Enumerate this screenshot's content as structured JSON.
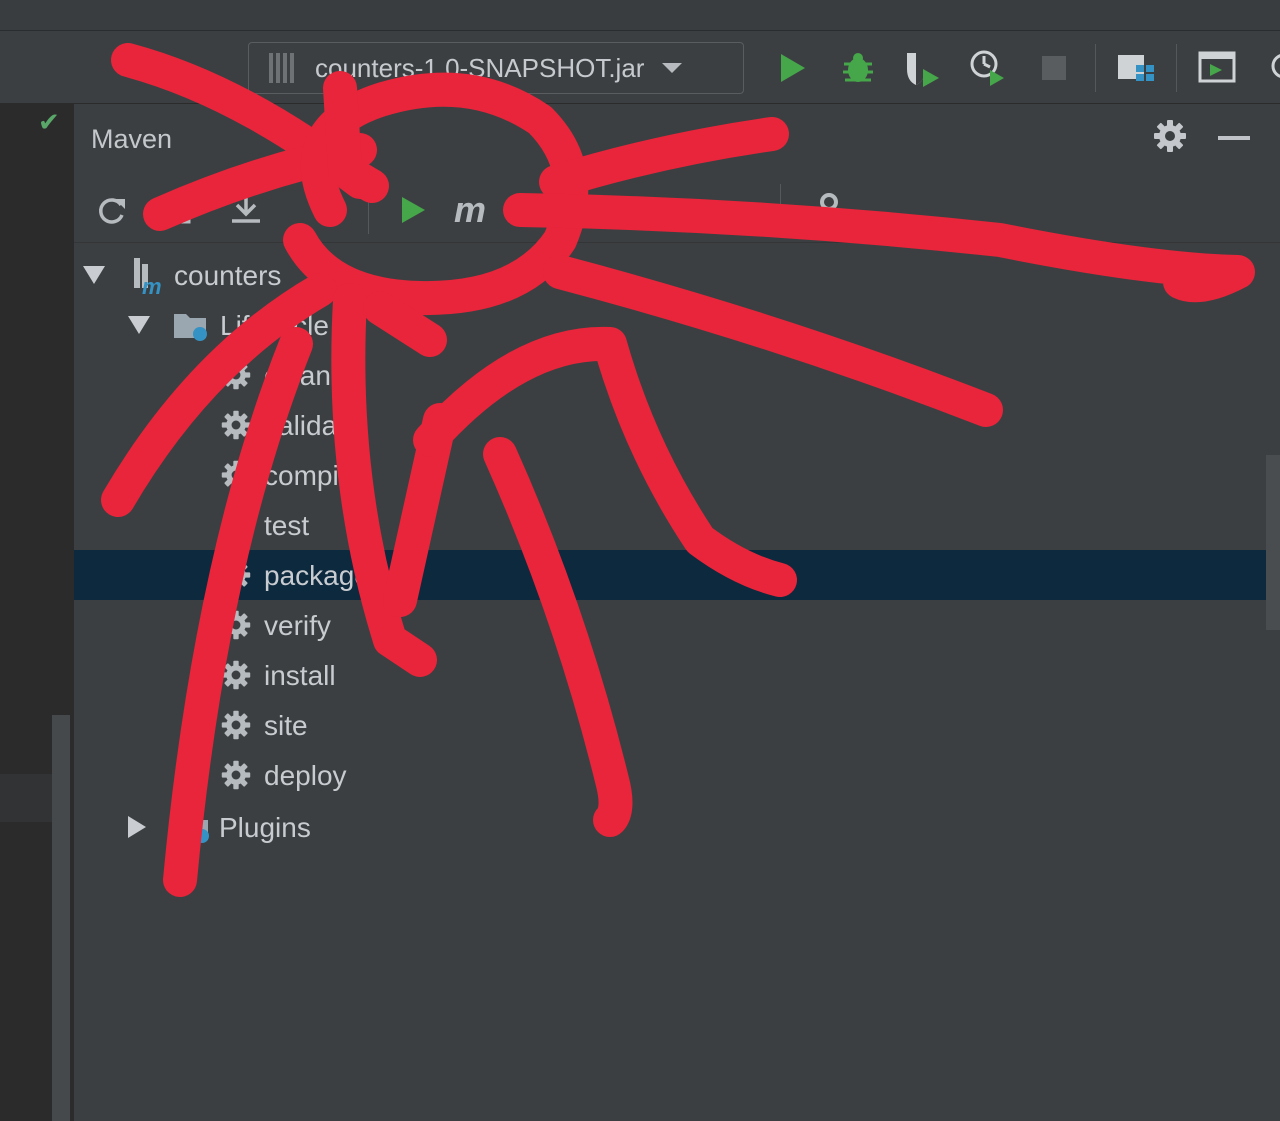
{
  "run_config": {
    "selected": "counters-1.0-SNAPSHOT.jar"
  },
  "toolbar": {
    "icons": [
      "run-icon",
      "debug-icon",
      "coverage-icon",
      "profile-icon",
      "stop-icon",
      "project-structure-icon",
      "terminal-icon",
      "search-icon"
    ]
  },
  "maven_panel": {
    "title": "Maven",
    "tools": [
      "reload-icon",
      "generate-sources-icon",
      "download-icon",
      "add-icon",
      "run-icon",
      "execute-goal-icon",
      "toggle-offline-icon",
      "skip-tests-icon",
      "show-dependencies-icon",
      "dropdown-icon",
      "settings-wrench-icon"
    ],
    "tree": {
      "project": {
        "label": "counters"
      },
      "lifecycle": {
        "label": "Lifecycle"
      },
      "goals": [
        "clean",
        "validate",
        "compile",
        "test",
        "package",
        "verify",
        "install",
        "site",
        "deploy"
      ],
      "selected_goal": "package",
      "plugins": {
        "label": "Plugins"
      }
    }
  },
  "colors": {
    "panel_bg": "#3c3f41",
    "selection": "#0d293e",
    "run_green": "#45a64a",
    "scribble": "#e8253a"
  }
}
